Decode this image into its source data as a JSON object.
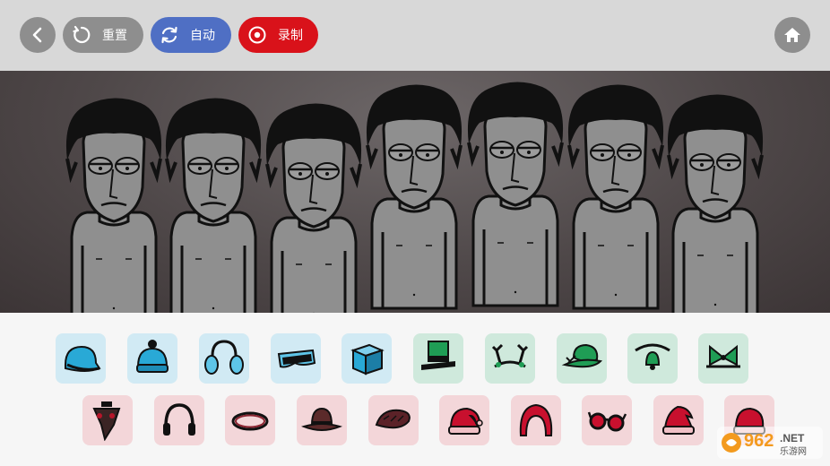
{
  "toolbar": {
    "back_icon": "chevron-left-icon",
    "reset_label": "重置",
    "auto_label": "自动",
    "record_label": "录制",
    "home_icon": "home-icon",
    "colors": {
      "gray": "#8e8e8e",
      "blue": "#4f6fc4",
      "red": "#d9121a"
    }
  },
  "stage": {
    "characters": [
      "character-1",
      "character-2",
      "character-3",
      "character-4",
      "character-5",
      "character-6",
      "character-7"
    ]
  },
  "tray": {
    "row1": [
      {
        "name": "cap-icon",
        "color": "blue"
      },
      {
        "name": "beanie-icon",
        "color": "blue"
      },
      {
        "name": "earmuffs-icon",
        "color": "blue"
      },
      {
        "name": "goggles-icon",
        "color": "blue"
      },
      {
        "name": "cube-icon",
        "color": "blue"
      },
      {
        "name": "top-hat-icon",
        "color": "green"
      },
      {
        "name": "antlers-icon",
        "color": "green"
      },
      {
        "name": "feather-hat-icon",
        "color": "green"
      },
      {
        "name": "bell-headband-icon",
        "color": "green"
      },
      {
        "name": "bow-icon",
        "color": "green"
      }
    ],
    "row2": [
      {
        "name": "plague-mask-icon",
        "color": "red"
      },
      {
        "name": "headphones-icon",
        "color": "red"
      },
      {
        "name": "halo-ring-icon",
        "color": "red"
      },
      {
        "name": "fedora-icon",
        "color": "red"
      },
      {
        "name": "hair-bun-icon",
        "color": "red"
      },
      {
        "name": "santa-hat-icon",
        "color": "red"
      },
      {
        "name": "hood-icon",
        "color": "red"
      },
      {
        "name": "round-glasses-icon",
        "color": "red"
      },
      {
        "name": "santa-hat-icon",
        "color": "red"
      },
      {
        "name": "santa-hat-icon",
        "color": "red"
      }
    ]
  },
  "watermark": {
    "number": "962",
    "suffix": ".NET",
    "sub": "乐游网"
  }
}
